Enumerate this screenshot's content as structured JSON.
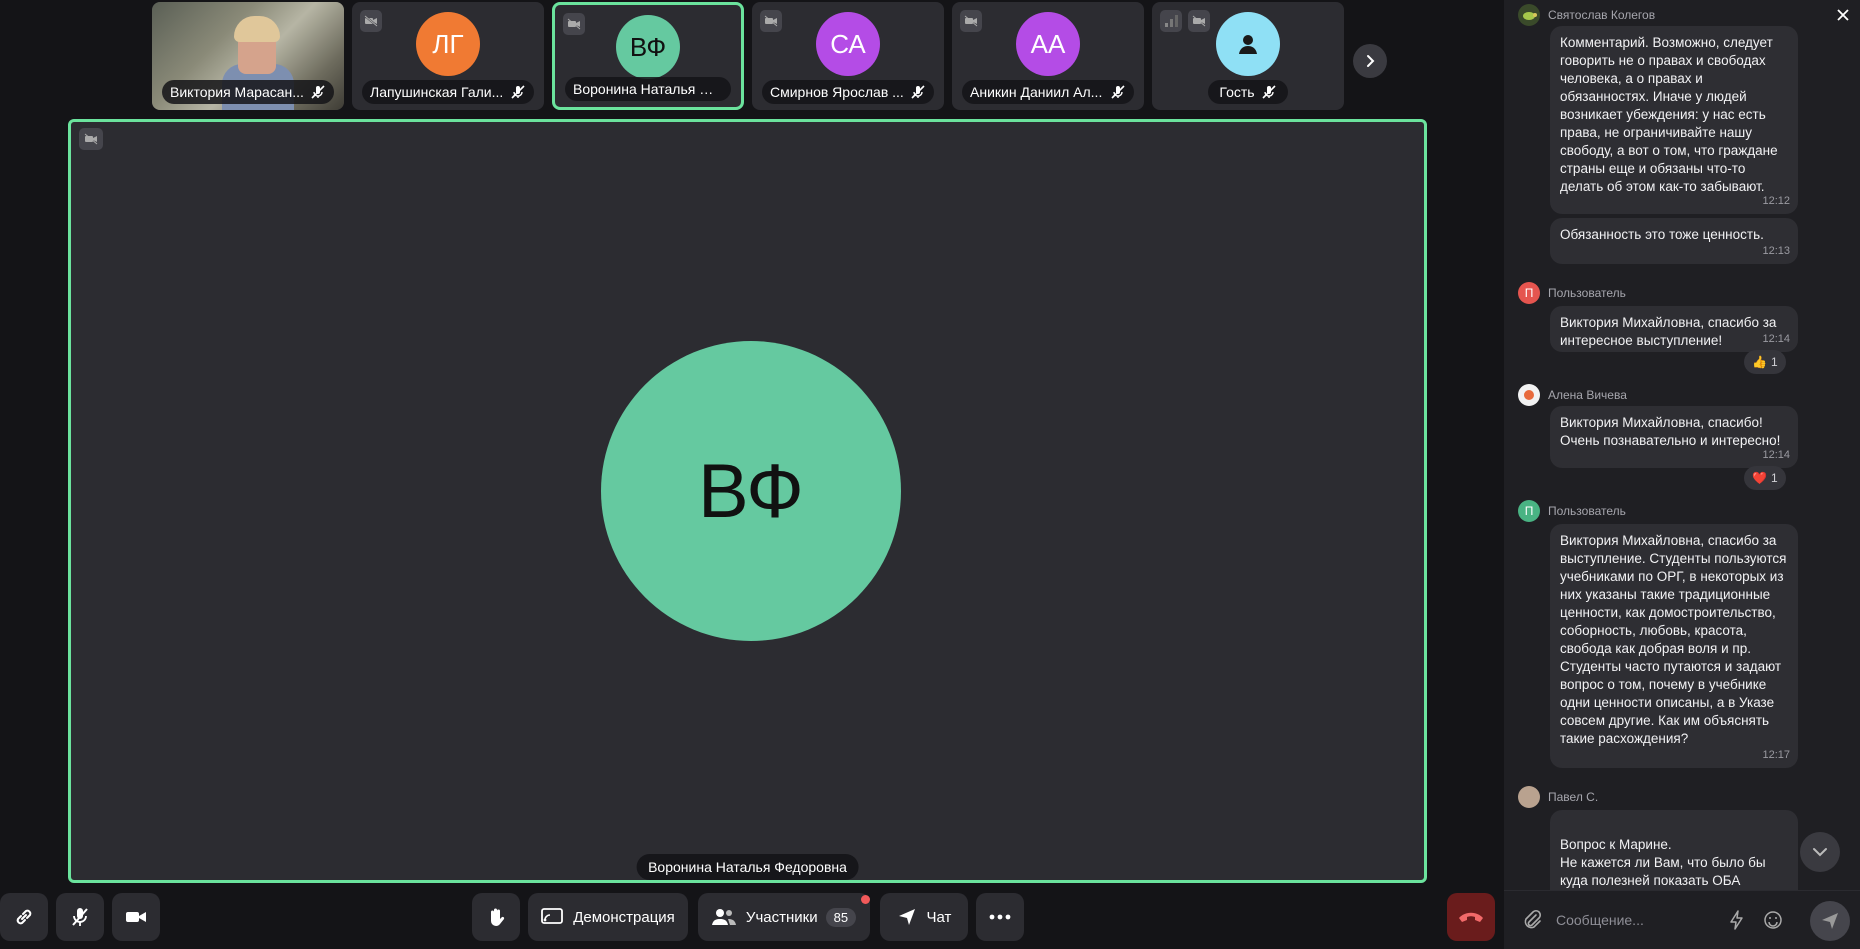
{
  "tiles": [
    {
      "name": "Виктория Марасан...",
      "type": "video"
    },
    {
      "name": "Лапушинская Гали...",
      "initials": "ЛГ",
      "color": "#f07a33"
    },
    {
      "name": "Воронина Наталья Фе...",
      "initials": "ВФ",
      "color": "#65c9a0",
      "active": true
    },
    {
      "name": "Смирнов Ярослав ...",
      "initials": "СА",
      "color": "#b44ce6"
    },
    {
      "name": "Аникин Даниил Ал...",
      "initials": "АА",
      "color": "#b44ce6"
    },
    {
      "name": "Гость",
      "color": "#8fe0f5"
    }
  ],
  "stage": {
    "initials": "ВФ",
    "name": "Воронина Наталья Федоровна"
  },
  "toolbar": {
    "demo_label": "Демонстрация",
    "participants_label": "Участники",
    "participants_count": "85",
    "chat_label": "Чат"
  },
  "chat": {
    "messages": [
      {
        "sender": "Святослав Колегов",
        "text": "Комментарий. Возможно, следует говорить не о правах и свободах человека, а о правах и обязанностях. Иначе у людей возникает убеждения: у нас есть права, не ограничивайте нашу свободу, а  вот о том, что граждане страны еще и обязаны что-то делать об этом как-то забывают.",
        "time": "12:12"
      },
      {
        "text": "Обязанность это тоже ценность.",
        "time": "12:13"
      },
      {
        "sender": "Пользователь",
        "avatar_letter": "П",
        "text": "Виктория Михайловна, спасибо за интересное выступление!",
        "time": "12:14",
        "reaction": "1"
      },
      {
        "sender": "Алена Вичева",
        "text": "Виктория Михайловна, спасибо! Очень познавательно и интересно!",
        "time": "12:14",
        "reaction": "1"
      },
      {
        "sender": "Пользователь",
        "avatar_letter": "П",
        "text": "Виктория Михайловна, спасибо за выступление. Студенты пользуются учебниками по ОРГ, в некоторых из них указаны такие традиционные ценности, как домостроительство, соборность, любовь, красота, свобода как добрая воля и пр. Студенты часто путаются и задают вопрос о том, почему в учебнике одни ценности описаны, а в Указе совсем другие. Как им объяснять такие расхождения?",
        "time": "12:17"
      },
      {
        "sender": "Павел С.",
        "text": "Вопрос к Марине.\nНе кажется ли Вам, что было бы куда полезней показать ОБА фильма, и старый, и новый, и"
      }
    ],
    "placeholder": "Сообщение..."
  }
}
